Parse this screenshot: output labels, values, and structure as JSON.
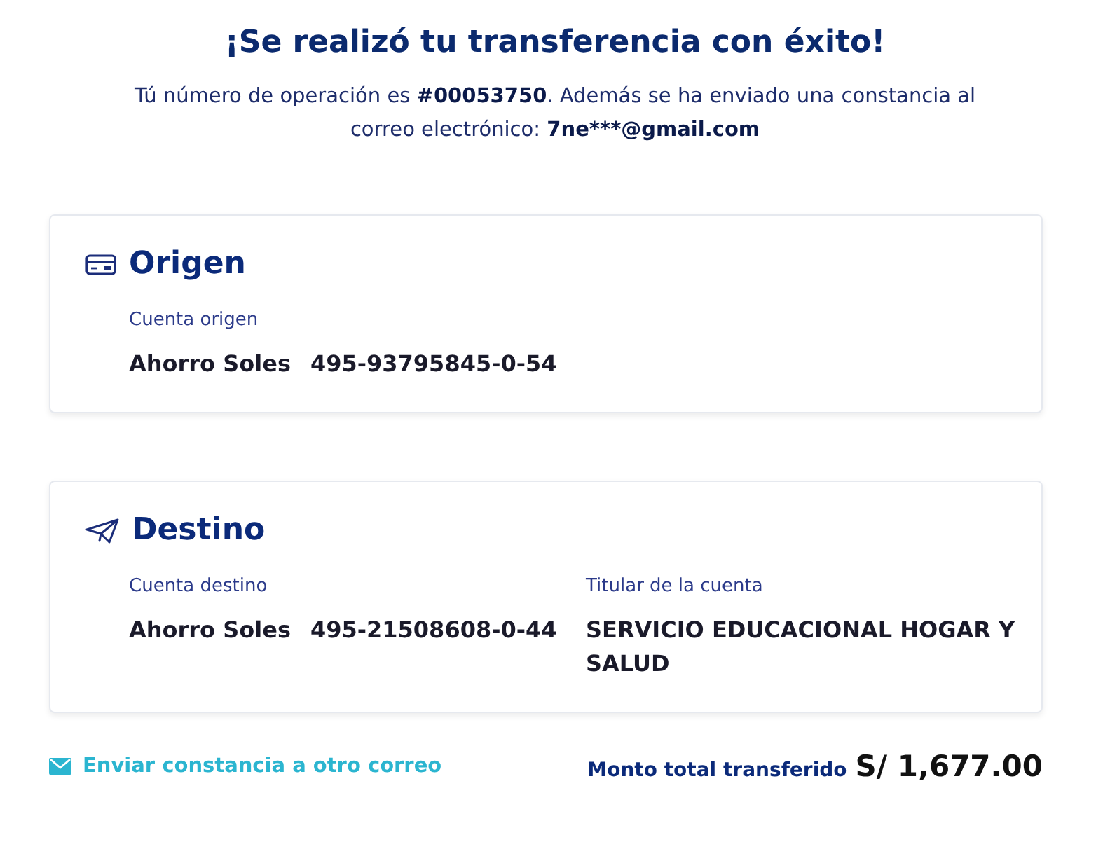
{
  "title": "¡Se realizó tu transferencia con éxito!",
  "message": [
    {
      "text": "Tú número de operación es ",
      "bold": false
    },
    {
      "text": "#00053750",
      "bold": true
    },
    {
      "text": ". Además se ha enviado una constancia al correo electrónico: ",
      "bold": false
    },
    {
      "text": "7ne***@gmail.com",
      "bold": true
    }
  ],
  "cards": [
    {
      "kind": "card",
      "heading": "Origen",
      "fields": [
        {
          "label": "Cuenta origen",
          "account_type": "Ahorro Soles",
          "account_number": "495-93795845-0-54"
        }
      ]
    },
    {
      "kind": "plane",
      "heading": "Destino",
      "fields": [
        {
          "label": "Cuenta destino",
          "account_type": "Ahorro Soles",
          "account_number": "495-21508608-0-44"
        },
        {
          "label": "Titular de la cuenta",
          "value": "SERVICIO EDUCACIONAL HOGAR Y SALUD"
        }
      ]
    }
  ],
  "footer": {
    "link": "Enviar constancia a otro correo",
    "total_label": "Monto total transferido",
    "total": "S/ 1,677.00"
  }
}
